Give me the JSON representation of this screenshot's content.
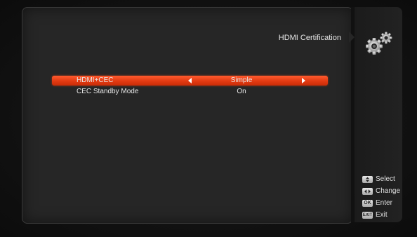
{
  "header": {
    "title": "HDMI Certification",
    "icon": "gear-icon"
  },
  "menu": {
    "items": [
      {
        "label": "HDMI+CEC",
        "value": "Simple",
        "selected": true
      },
      {
        "label": "CEC Standby Mode",
        "value": "On",
        "selected": false
      }
    ]
  },
  "legend": {
    "select": {
      "key": "up-down-icon",
      "label": "Select"
    },
    "change": {
      "key": "left-right-icon",
      "label": "Change"
    },
    "enter": {
      "key": "OK",
      "label": "Enter"
    },
    "exit": {
      "key": "EXIT",
      "label": "Exit"
    }
  },
  "colors": {
    "highlight": "#e8401a",
    "panel": "#262626",
    "background": "#0c0c0c",
    "text": "#e8e8e8"
  }
}
